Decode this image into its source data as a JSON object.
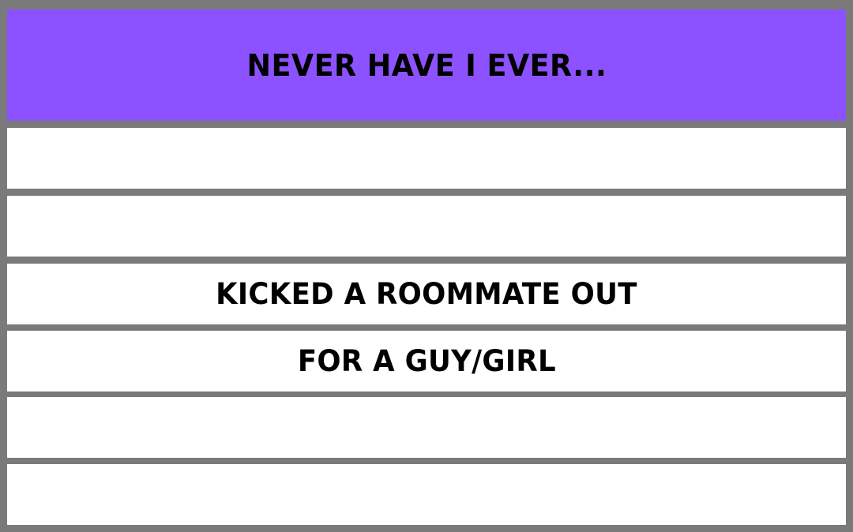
{
  "colors": {
    "header_background": "#8c52ff",
    "row_background": "#ffffff",
    "border": "#7a7a7a",
    "text": "#000000"
  },
  "header": {
    "title": "NEVER HAVE I EVER..."
  },
  "rows": [
    {
      "text": ""
    },
    {
      "text": ""
    },
    {
      "text": "KICKED A ROOMMATE OUT"
    },
    {
      "text": "FOR A GUY/GIRL"
    },
    {
      "text": ""
    },
    {
      "text": ""
    }
  ]
}
